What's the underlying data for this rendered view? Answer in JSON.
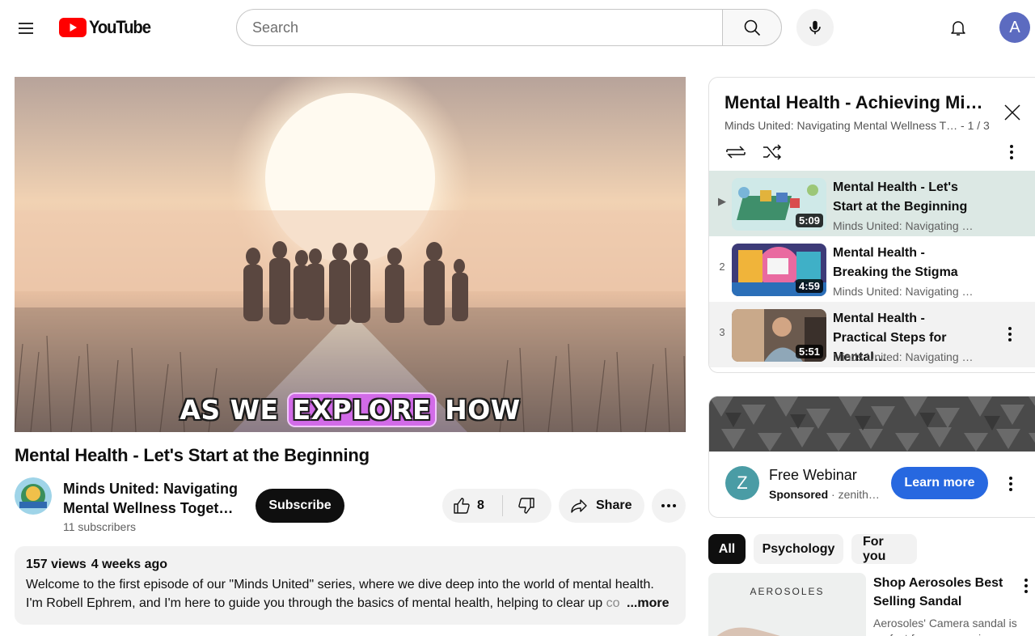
{
  "header": {
    "logo_text": "YouTube",
    "search_placeholder": "Search",
    "avatar_initial": "A"
  },
  "video": {
    "caption_before": "AS WE ",
    "caption_highlight": "EXPLORE",
    "caption_after": " HOW",
    "title": "Mental Health - Let's Start at the Beginning",
    "channel_name": "Minds United: Navigating Mental Wellness Toget…",
    "subscribers": "11 subscribers",
    "subscribe_label": "Subscribe",
    "like_count": "8",
    "share_label": "Share",
    "views": "157 views",
    "age": "4 weeks ago",
    "description_line1": "Welcome to the first episode of our \"Minds United\" series, where we dive deep into the world of mental health.",
    "description_line2": "I'm Robell Ephrem, and I'm here to guide you through the basics of mental health, helping to clear up ",
    "description_fade": "co",
    "more_label": "...more"
  },
  "playlist": {
    "title": "Mental Health - Achieving Mi…",
    "subtitle": "Minds United: Navigating Mental Wellness T…  - 1 / 3",
    "items": [
      {
        "index": "▶",
        "title": "Mental Health - Let's Start at the Beginning",
        "channel": "Minds United: Navigating …",
        "duration": "5:09"
      },
      {
        "index": "2",
        "title": "Mental Health - Breaking the Stigma",
        "channel": "Minds United: Navigating …",
        "duration": "4:59"
      },
      {
        "index": "3",
        "title": "Mental Health - Practical Steps for Mental…",
        "channel": "Minds United: Navigating …",
        "duration": "5:51"
      }
    ]
  },
  "ad": {
    "logo_letter": "Z",
    "title": "Free Webinar",
    "sponsored": "Sponsored",
    "advertiser": " · zenith…",
    "cta": "Learn more"
  },
  "chips": [
    "All",
    "Psychology",
    "For you"
  ],
  "suggestion": {
    "brand": "AEROSOLES",
    "title": "Shop Aerosoles Best Selling Sandal",
    "description": "Aerosoles' Camera sandal is perfect for any occasion"
  },
  "colors": {
    "brand_red": "#ff0000",
    "subscribe_bg": "#0f0f0f",
    "cta_blue": "#2768e0",
    "active_item_bg": "#dce8e4",
    "avatar_bg": "#5c6bc0"
  }
}
